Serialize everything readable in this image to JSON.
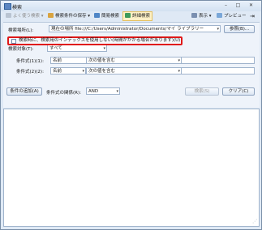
{
  "window": {
    "title": "検索"
  },
  "title_controls": {
    "minimize": "–",
    "maximize": "□",
    "close": "✕"
  },
  "toolbar": {
    "recent": "よく使う検索",
    "save_conditions": "検索条件の保存",
    "simple_search": "簡易検索",
    "advanced_search": "詳細検索",
    "view": "表示",
    "preview": "プレビュー"
  },
  "location": {
    "label": "検索場所(L):",
    "value": "現在の場所 file:///C:/Users/Administrator/Documents/マイ ライブラリー",
    "browse_button": "参照(B)..."
  },
  "index_option": {
    "label": "検索時に、検索用のインデックスを使用しない(時間がかかる場合があります)(U)"
  },
  "search_target": {
    "label": "検索対象(T):",
    "value": "すべて"
  },
  "conditions": [
    {
      "label": "条件式(1)(1):",
      "field": "名前",
      "operator": "次の値を含む",
      "value": ""
    },
    {
      "label": "条件式(2)(2):",
      "field": "名前",
      "operator": "次の値を含む",
      "value": ""
    }
  ],
  "footer": {
    "add_condition": "条件の追加(A)",
    "relation_label": "条件式の関係(R):",
    "relation_value": "AND",
    "search_button": "検索(S)",
    "clear_button": "クリア(C)"
  },
  "colors": {
    "highlight_border": "#e01818",
    "panel": "#eef3fa"
  }
}
